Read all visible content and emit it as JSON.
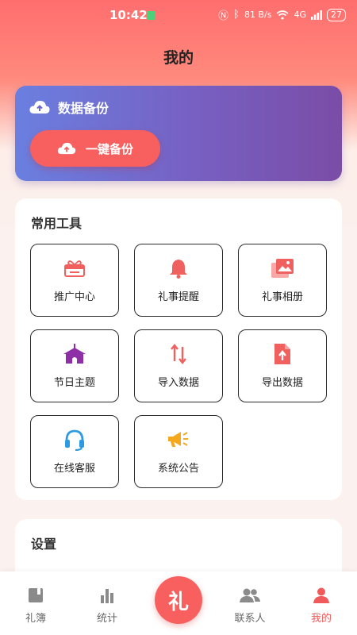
{
  "status_bar": {
    "time": "10:42",
    "network_speed": "81 B/s",
    "signal": "4G",
    "battery": "27"
  },
  "page": {
    "title": "我的"
  },
  "backup": {
    "title": "数据备份",
    "button_label": "一键备份"
  },
  "tools": {
    "title": "常用工具",
    "items": [
      {
        "label": "推广中心",
        "icon": "gift-card-icon",
        "color": "#f0605f"
      },
      {
        "label": "礼事提醒",
        "icon": "bell-icon",
        "color": "#f0605f"
      },
      {
        "label": "礼事相册",
        "icon": "photo-album-icon",
        "color": "#f0605f"
      },
      {
        "label": "节日主题",
        "icon": "house-theme-icon",
        "color": "#8e2fa8"
      },
      {
        "label": "导入数据",
        "icon": "import-arrows-icon",
        "color": "#f0605f"
      },
      {
        "label": "导出数据",
        "icon": "export-file-icon",
        "color": "#f0605f"
      },
      {
        "label": "在线客服",
        "icon": "headset-icon",
        "color": "#2e9be0"
      },
      {
        "label": "系统公告",
        "icon": "megaphone-icon",
        "color": "#f5a81c"
      }
    ]
  },
  "settings": {
    "title": "设置"
  },
  "tabbar": {
    "items": [
      {
        "label": "礼簿",
        "icon": "book-icon"
      },
      {
        "label": "统计",
        "icon": "bar-chart-icon"
      },
      {
        "label": "礼",
        "icon": "center-gift-button"
      },
      {
        "label": "联系人",
        "icon": "contacts-icon"
      },
      {
        "label": "我的",
        "icon": "person-icon"
      }
    ],
    "active": "我的"
  },
  "colors": {
    "accent": "#f7605f",
    "backup_gradient_start": "#6a7fe0",
    "backup_gradient_end": "#7a4da6",
    "tab_inactive": "#888888"
  }
}
